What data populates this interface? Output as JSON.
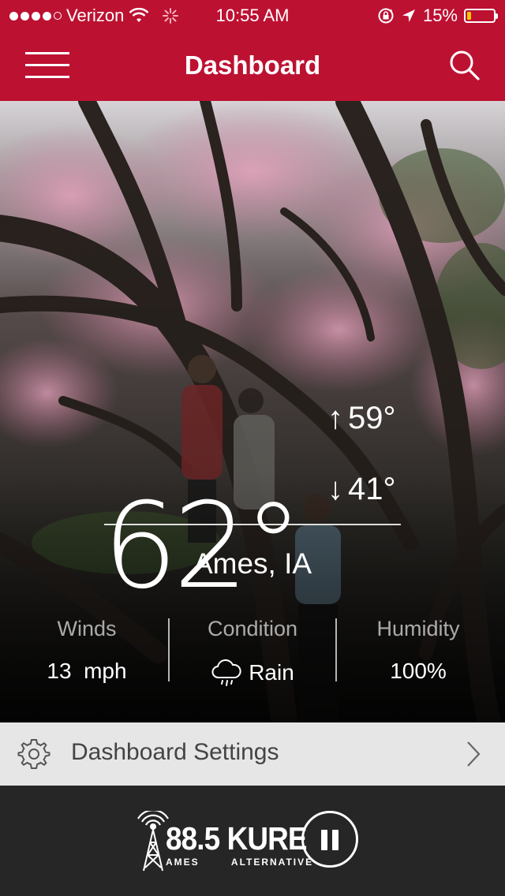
{
  "status_bar": {
    "carrier": "Verizon",
    "time": "10:55 AM",
    "battery": "15%",
    "battery_level": 0.15
  },
  "nav": {
    "title": "Dashboard"
  },
  "weather": {
    "current_temp": "62°",
    "high": "59°",
    "low": "41°",
    "city": "Ames, IA",
    "stats": [
      {
        "label": "Winds",
        "value": "13  mph"
      },
      {
        "label": "Condition",
        "value": "Rain"
      },
      {
        "label": "Humidity",
        "value": "100%"
      }
    ]
  },
  "settings": {
    "label": "Dashboard Settings"
  },
  "player": {
    "station": "88.5 KURE",
    "tagline_left": "AMES",
    "tagline_right": "ALTERNATIVE",
    "state": "playing"
  },
  "colors": {
    "brand_red": "#bd1132",
    "player_bg": "#262626",
    "settings_bg": "#e6e6e6"
  }
}
